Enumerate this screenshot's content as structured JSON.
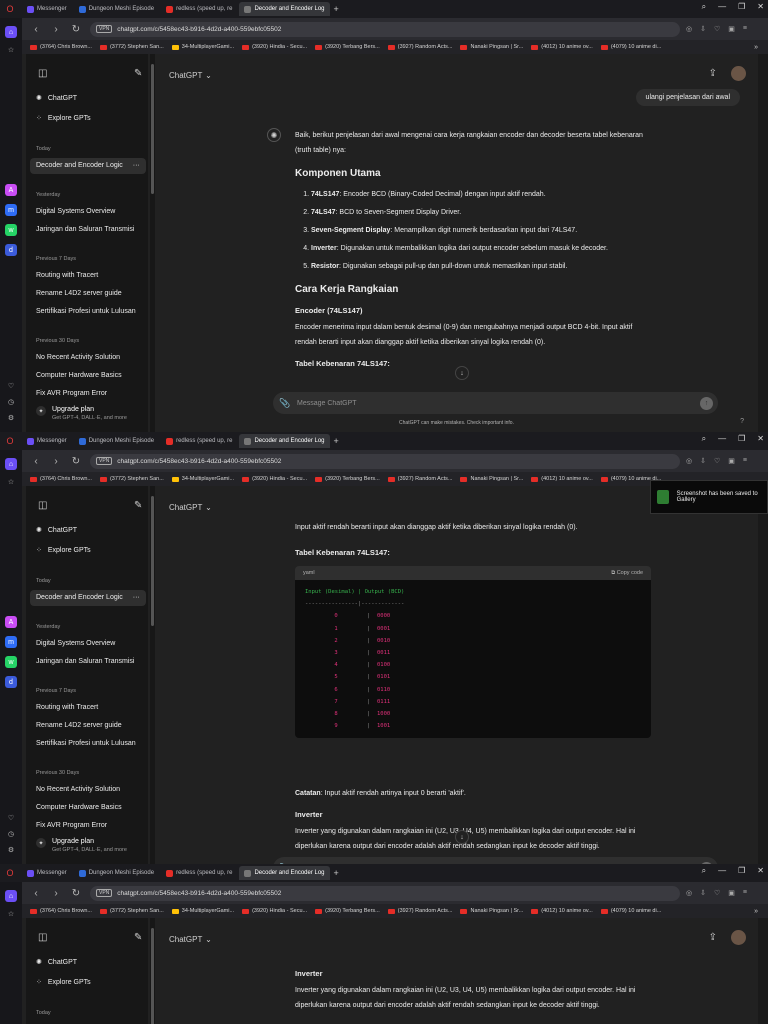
{
  "browser": {
    "tabs": [
      "Messenger",
      "Dungeon Meshi Episode",
      "redless (speed up, re",
      "Decoder and Encoder Log"
    ],
    "active_tab": 3,
    "new_tab": "+",
    "url": "chatgpt.com/c/5458ec43-b916-4d2d-a400-559ebfc05502",
    "vpn": "VPN",
    "bookmarks": [
      "(3764) Chris Brown...",
      "(3772) Stephen San...",
      "34-MultiplayerGami...",
      "(3920) Hindia - Secu...",
      "(3920) Terbang Bers...",
      "(3927) Random Acts...",
      "Nanaki Pingsan | Sr...",
      "(4012) 10 anime ov...",
      "(4079) 10 anime di..."
    ],
    "bookmarks_more": "»"
  },
  "sidebar": {
    "chatgpt": "ChatGPT",
    "explore": "Explore GPTs",
    "today_label": "Today",
    "today_items": [
      "Decoder and Encoder Logic"
    ],
    "yesterday_label": "Yesterday",
    "yesterday_items": [
      "Digital Systems Overview",
      "Jaringan dan Saluran Transmisi"
    ],
    "prev7_label": "Previous 7 Days",
    "prev7_items": [
      "Routing with Tracert",
      "Rename L4D2 server guide",
      "Sertifikasi Profesi untuk Lulusan"
    ],
    "prev30_label": "Previous 30 Days",
    "prev30_items": [
      "No Recent Activity Solution",
      "Computer Hardware Basics",
      "Fix AVR Program Error"
    ],
    "upgrade_title": "Upgrade plan",
    "upgrade_sub": "Get GPT-4, DALL·E, and more",
    "more": "···"
  },
  "header": {
    "model": "ChatGPT",
    "caret": "⌄"
  },
  "conversation": {
    "user_msg": "ulangi penjelasan dari awal",
    "intro": "Baik, berikut penjelasan dari awal mengenai cara kerja rangkaian encoder dan decoder beserta tabel kebenaran (truth table) nya:",
    "h_components": "Komponen Utama",
    "components": [
      {
        "name": "74LS147",
        "text": ": Encoder BCD (Binary-Coded Decimal) dengan input aktif rendah."
      },
      {
        "name": "74LS47",
        "text": ": BCD to Seven-Segment Display Driver."
      },
      {
        "name": "Seven-Segment Display",
        "text": ": Menampilkan digit numerik berdasarkan input dari 74LS47."
      },
      {
        "name": "Inverter",
        "text": ": Digunakan untuk membalikkan logika dari output encoder sebelum masuk ke decoder."
      },
      {
        "name": "Resistor",
        "text": ": Digunakan sebagai pull-up dan pull-down untuk memastikan input stabil."
      }
    ],
    "h_how": "Cara Kerja Rangkaian",
    "h_encoder": "Encoder (74LS147)",
    "encoder_p1": "Encoder menerima input dalam bentuk desimal (0-9) dan mengubahnya menjadi output BCD 4-bit.",
    "encoder_p2": "Input aktif rendah berarti input akan dianggap aktif ketika diberikan sinyal logika rendah (0).",
    "h_table": "Tabel Kebenaran 74LS147:",
    "code_lang": "yaml",
    "copy_label": "Copy code",
    "code_header": "Input (Desimal) | Output (BCD)",
    "code_sep": "----------------|-------------",
    "rows": [
      [
        "0",
        "0000"
      ],
      [
        "1",
        "0001"
      ],
      [
        "2",
        "0010"
      ],
      [
        "3",
        "0011"
      ],
      [
        "4",
        "0100"
      ],
      [
        "5",
        "0101"
      ],
      [
        "6",
        "0110"
      ],
      [
        "7",
        "0111"
      ],
      [
        "8",
        "1000"
      ],
      [
        "9",
        "1001"
      ]
    ],
    "note_label": "Catatan",
    "note_text": ": Input aktif rendah artinya input 0 berarti 'aktif'.",
    "h_inverter": "Inverter",
    "inverter_p": "Inverter yang digunakan dalam rangkaian ini (U2, U3, U4, U5) membalikkan logika dari output encoder. Hal ini diperlukan karena output dari encoder adalah aktif rendah sedangkan input ke decoder aktif tinggi."
  },
  "composer": {
    "placeholder": "Message ChatGPT",
    "disclaimer": "ChatGPT can make mistakes. Check important info."
  },
  "toast": "Screenshot has been saved to Gallery"
}
